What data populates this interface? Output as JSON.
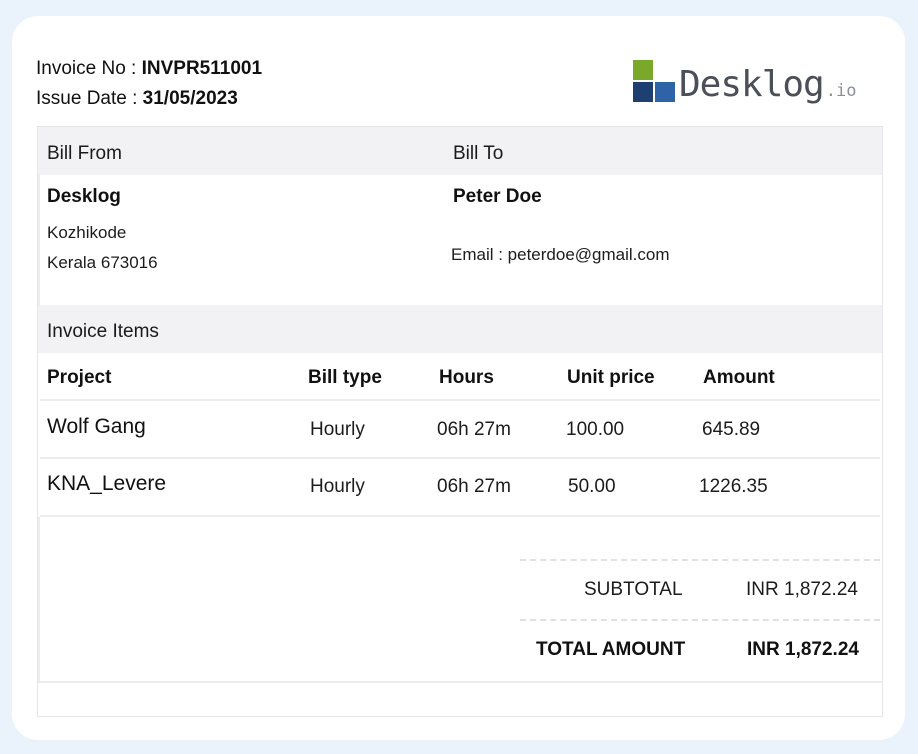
{
  "invoice": {
    "number_label": "Invoice No : ",
    "number": "INVPR511001",
    "date_label": "Issue Date : ",
    "date": "31/05/2023"
  },
  "logo": {
    "word": "Desklog",
    "suffix": ".io",
    "colors": {
      "green": "#7aa82a",
      "navy": "#1d3f72",
      "blue": "#2f63a8"
    }
  },
  "bill": {
    "from_label": "Bill From",
    "to_label": "Bill To",
    "from": {
      "name": "Desklog",
      "line1": "Kozhikode",
      "line2": "Kerala 673016"
    },
    "to": {
      "name": "Peter Doe",
      "email_line": "Email : peterdoe@gmail.com"
    }
  },
  "items": {
    "section_label": "Invoice Items",
    "headers": [
      "Project",
      "Bill type",
      "Hours",
      "Unit price",
      "Amount"
    ],
    "rows": [
      {
        "project": "Wolf Gang",
        "bill_type": "Hourly",
        "hours": "06h 27m",
        "unit_price": "100.00",
        "amount": "645.89"
      },
      {
        "project": "KNA_Levere",
        "bill_type": "Hourly",
        "hours": "06h 27m",
        "unit_price": "50.00",
        "amount": "1226.35"
      }
    ]
  },
  "summary": {
    "subtotal_label": "SUBTOTAL",
    "subtotal_value": "INR 1,872.24",
    "total_label": "TOTAL AMOUNT",
    "total_value": "INR 1,872.24"
  }
}
